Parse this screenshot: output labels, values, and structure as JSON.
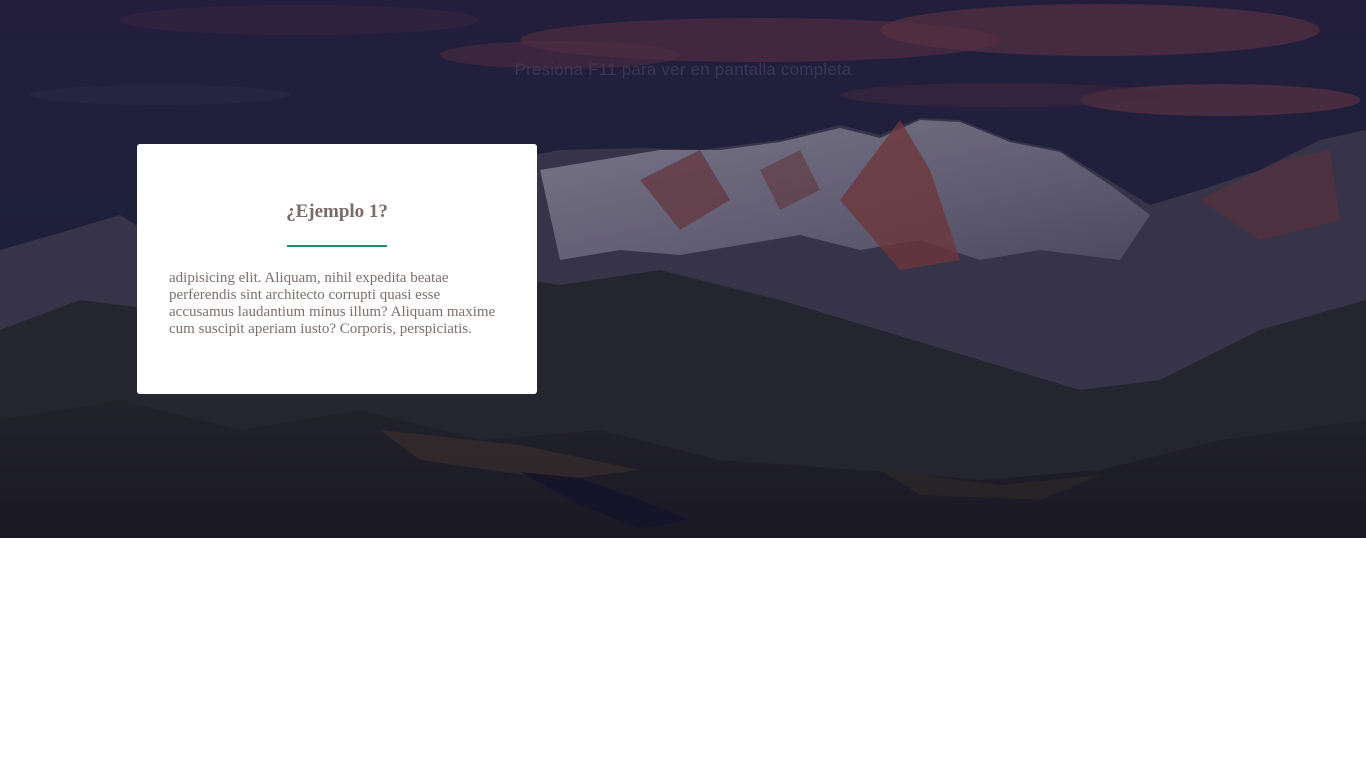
{
  "hero": {
    "fullscreen_hint": "Presiona F11 para ver en pantalla completa"
  },
  "card": {
    "title": "¿Ejemplo 1?",
    "body": "adipisicing elit. Aliquam, nihil expedita beatae perferendis sint architecto corrupti quasi esse accusamus laudantium minus illum? Aliquam maxime cum suscipit aperiam iusto? Corporis, perspiciatis.",
    "accent_color": "#1e8c78"
  },
  "background": {
    "image_subject": "mountain-landscape-at-sunset",
    "overlay_color": "#1b1d3a"
  }
}
